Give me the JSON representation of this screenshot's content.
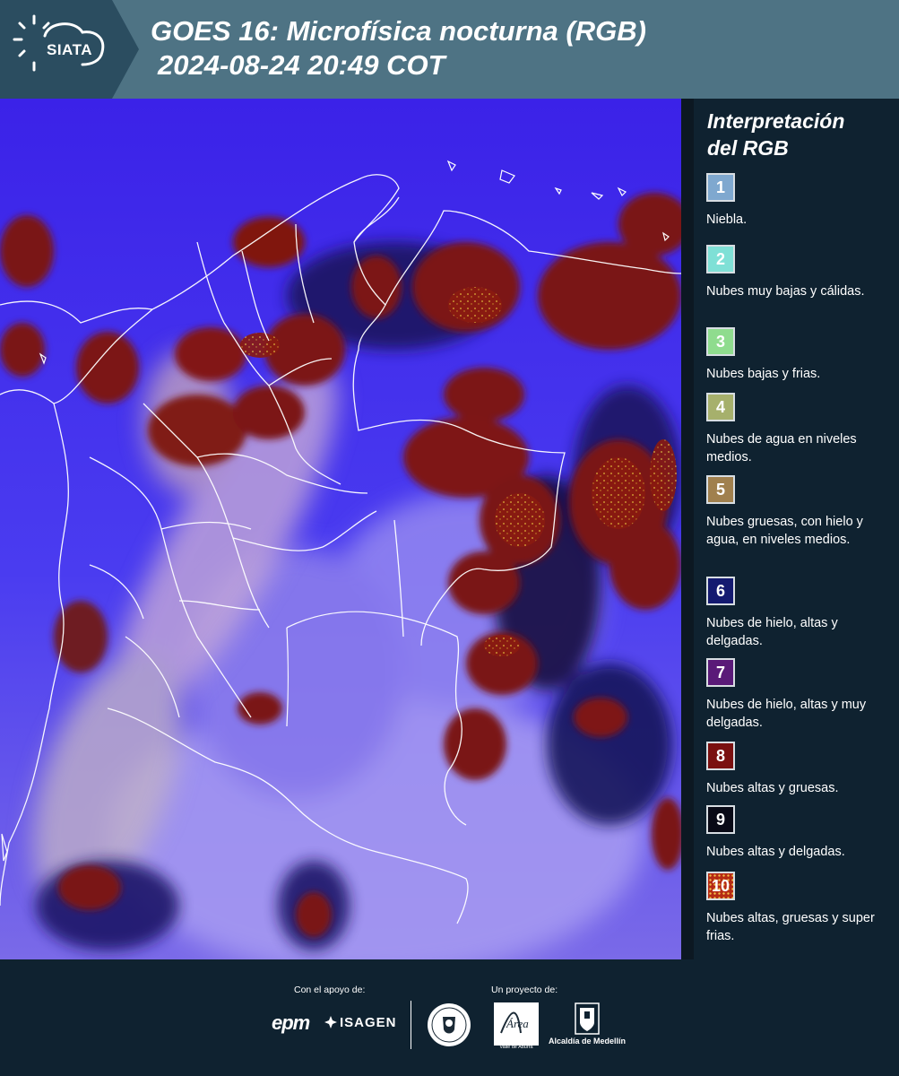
{
  "header": {
    "logo_text": "SIATA",
    "title_line1": "GOES 16: Microfísica nocturna (RGB)",
    "title_line2": "2024-08-24 20:49 COT"
  },
  "legend": {
    "title_line1": "Interpretación",
    "title_line2": "del RGB",
    "items": [
      {
        "number": "1",
        "label": "Niebla.",
        "color": "#7fa8cf"
      },
      {
        "number": "2",
        "label": "Nubes muy bajas y cálidas.",
        "color": "#7fe0d6"
      },
      {
        "number": "3",
        "label": "Nubes bajas y frias.",
        "color": "#8fdc8e"
      },
      {
        "number": "4",
        "label": "Nubes de agua en niveles medios.",
        "color": "#a6b06c"
      },
      {
        "number": "5",
        "label": "Nubes gruesas, con hielo y agua, en niveles medios.",
        "color": "#a0804e"
      },
      {
        "number": "6",
        "label": "Nubes de hielo, altas y delgadas.",
        "color": "#141a70"
      },
      {
        "number": "7",
        "label": "Nubes de hielo, altas y muy delgadas.",
        "color": "#5a1a78"
      },
      {
        "number": "8",
        "label": "Nubes altas y gruesas.",
        "color": "#7a1010"
      },
      {
        "number": "9",
        "label": "Nubes altas y delgadas.",
        "color": "#090a16"
      },
      {
        "number": "10",
        "label": "Nubes altas, gruesas y super frias.",
        "color": "#b52a14"
      }
    ]
  },
  "footer": {
    "support_label": "Con el apoyo de:",
    "project_label": "Un proyecto de:",
    "epm": "epm",
    "isagen": "ISAGEN",
    "area_text": "METROPOLITANA Valle de Aburrá",
    "area_script": "Área",
    "alcaldia": "Alcaldía de Medellín"
  }
}
